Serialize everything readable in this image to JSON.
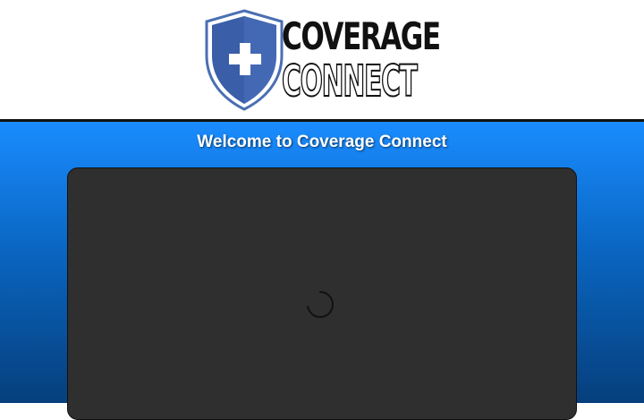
{
  "header": {
    "logo": {
      "word1": "COVERAGE",
      "word2": "CONNECT",
      "shield_icon": "shield-cross-icon",
      "shield_color": "#4a6fb3",
      "shield_inner_color": "#3b5ea8"
    }
  },
  "main": {
    "welcome_text": "Welcome to Coverage Connect",
    "loading_icon": "loading-spinner-icon",
    "background_top": "#1a8cff",
    "background_bottom": "#063f7c",
    "panel_color": "#2f2f2f"
  }
}
